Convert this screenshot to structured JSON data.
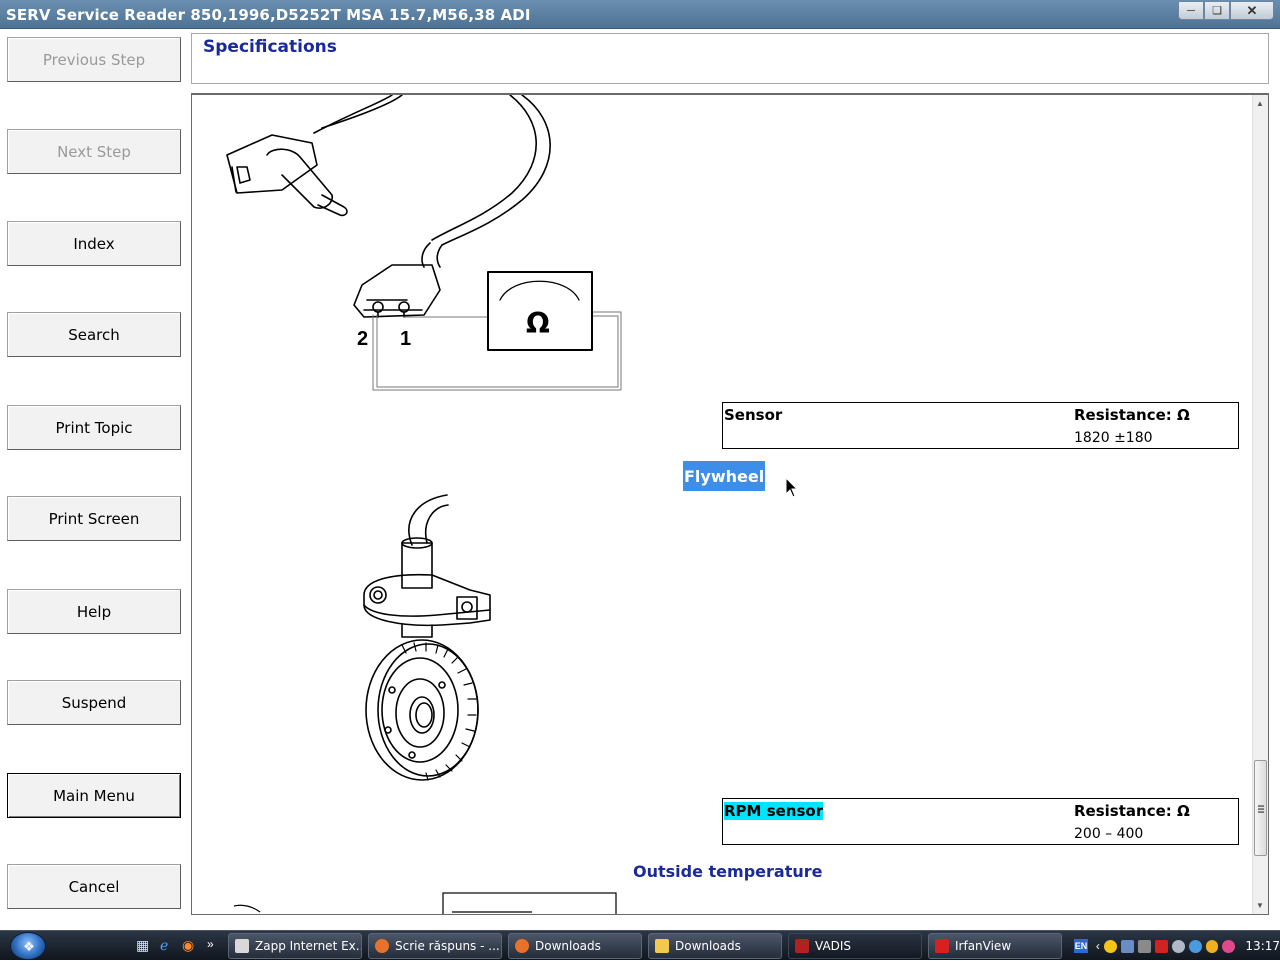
{
  "window": {
    "title": "SERV Service Reader 850,1996,D5252T MSA 15.7,M56,38 ADI"
  },
  "nav": {
    "previous_step": "Previous Step",
    "next_step": "Next Step",
    "index": "Index",
    "search": "Search",
    "print_topic": "Print Topic",
    "print_screen": "Print Screen",
    "help": "Help",
    "suspend": "Suspend",
    "main_menu": "Main Menu",
    "cancel": "Cancel"
  },
  "header": {
    "title": "Specifications"
  },
  "content": {
    "diagram1": {
      "pin2": "2",
      "pin1": "1",
      "ohm_symbol": "Ω"
    },
    "sensor_table": {
      "col1": "Sensor",
      "col2": "Resistance: Ω",
      "value": "1820 ±180"
    },
    "flywheel_label": "Flywheel",
    "rpm_table": {
      "col1": "RPM sensor",
      "col2": "Resistance: Ω",
      "value": "200 – 400"
    },
    "outside_temperature": "Outside temperature"
  },
  "taskbar": {
    "tasks": [
      {
        "label": "Zapp Internet Ex...",
        "color": "#d8d8d8"
      },
      {
        "label": "Scrie răspuns - ...",
        "color": "#e8722a"
      },
      {
        "label": "Downloads",
        "color": "#e8722a"
      },
      {
        "label": "Downloads",
        "color": "#f2c94c"
      },
      {
        "label": "VADIS",
        "color": "#b32020"
      },
      {
        "label": "IrfanView",
        "color": "#d82020"
      }
    ],
    "lang": "EN",
    "clock": "13:17"
  }
}
